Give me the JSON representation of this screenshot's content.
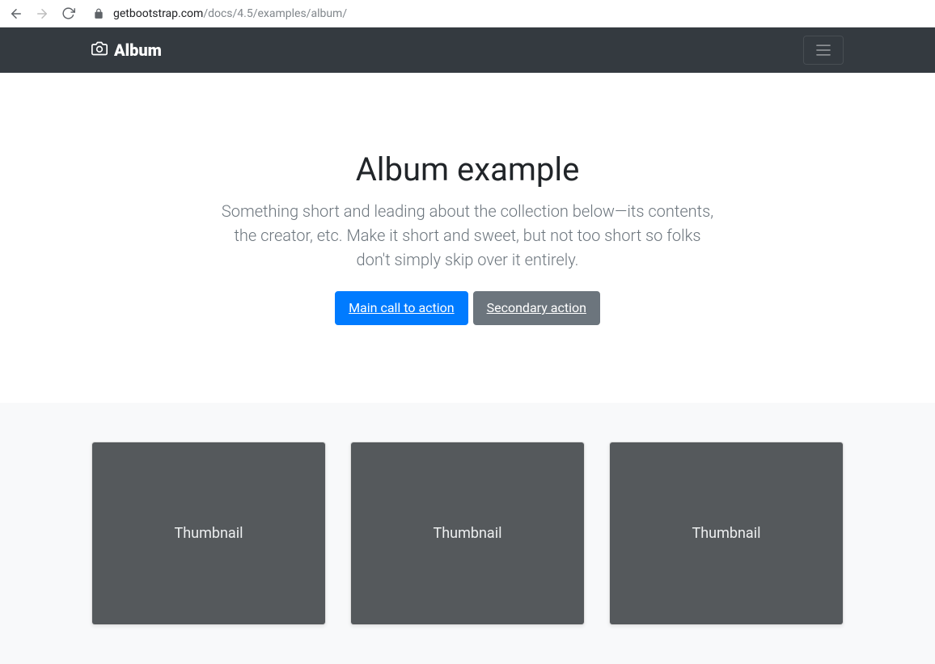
{
  "browser": {
    "url_host": "getbootstrap.com",
    "url_path": "/docs/4.5/examples/album/"
  },
  "navbar": {
    "brand_label": "Album"
  },
  "jumbotron": {
    "title": "Album example",
    "lead": "Something short and leading about the collection below—its contents, the creator, etc. Make it short and sweet, but not too short so folks don't simply skip over it entirely.",
    "primary_button_label": "Main call to action",
    "secondary_button_label": "Secondary action"
  },
  "album": {
    "cards": [
      {
        "thumbnail_label": "Thumbnail"
      },
      {
        "thumbnail_label": "Thumbnail"
      },
      {
        "thumbnail_label": "Thumbnail"
      }
    ]
  }
}
